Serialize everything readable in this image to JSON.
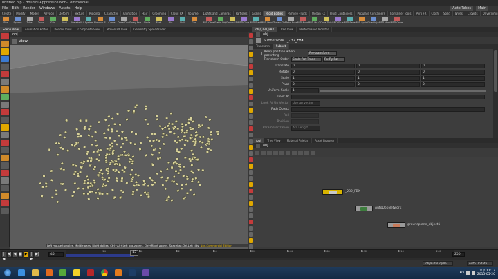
{
  "window": {
    "title": "untitled.hip - Houdini Apprentice Non-Commercial"
  },
  "menu": {
    "items": [
      "File",
      "Edit",
      "Render",
      "Windows",
      "Assets",
      "Help"
    ],
    "right_dropdown": "Auto Takes",
    "right_button": "Main"
  },
  "shelf_tabs": {
    "left": [
      "Create",
      "Modify",
      "Model",
      "Polygon",
      "Deform",
      "Texture",
      "Rigging",
      "Character",
      "Animation",
      "Hair",
      "Grooming",
      "Cloud FX",
      "Volume"
    ],
    "right": [
      "Lights and Cameras",
      "Particles",
      "Grains",
      "Rigid Bodies",
      "Particle Fluids",
      "Ocean FX",
      "Fluid Containers",
      "Populate Containers",
      "Container Tools",
      "Pyro FX",
      "Cloth",
      "Solid",
      "Wires",
      "Crowds",
      "Drive Simulation"
    ],
    "active_right": "Rigid Bodies"
  },
  "shelf_tools": {
    "left": [
      "Box",
      "Sphere",
      "Tube",
      "Torus",
      "Grid",
      "Null",
      "Metaball",
      "L-System",
      "Platonic Sol.",
      "Curve",
      "Draw Curve",
      "Spray Paint",
      "Circle",
      "Font",
      "File",
      "Null",
      "Geo"
    ],
    "right": [
      "RBD Object",
      "Static Object",
      "Ground Plane",
      "RBD Glue Object",
      "RBD Fractured Object",
      "RBD Point Object",
      "Terrain Object",
      "Make Breakable",
      "RBD Auto Freeze",
      "RBD Pin Constraint",
      "Cone Twist",
      "RBD Glue",
      "RBD Sever",
      "RBD Spring Constraint",
      "Glue Adjacent",
      "RBD Hard Constraint",
      "RBD Cone Twist"
    ]
  },
  "left_tabs": [
    "Scene View",
    "Animation Editor",
    "Render View",
    "Composite View",
    "Motion FX View",
    "Geometry Spreadsheet"
  ],
  "viewport": {
    "path": "obj",
    "view_label": "View"
  },
  "viewport_status": {
    "text": "Left mouse tumbles. Middle pans. Right dollies. Ctrl+Alt+Left box-zooms. Ctrl+Right zooms. Spacebar-Ctrl-Left tilts.",
    "badge": "Non-Commercial Edition"
  },
  "param_tabs": [
    "/obj/_232_FBX",
    "Tree View",
    "Performance Monitor"
  ],
  "params": {
    "path": "obj",
    "node_type": "Subnetwork",
    "node_name": "_232_FBX",
    "tabs": [
      "Transform",
      "Subnet"
    ],
    "keep_position_label": "Keep position when parenting",
    "keep_position_value": "Pre-transform",
    "transform_order_label": "Transform Order",
    "transform_order": "Scale Rot Trans",
    "rotate_order": "Rx Ry Rz",
    "rows": [
      {
        "label": "Translate",
        "v": [
          "0",
          "0",
          "0"
        ]
      },
      {
        "label": "Rotate",
        "v": [
          "0",
          "0",
          "0"
        ]
      },
      {
        "label": "Scale",
        "v": [
          "1",
          "1",
          "1"
        ]
      },
      {
        "label": "Pivot",
        "v": [
          "0",
          "0",
          "0"
        ]
      }
    ],
    "uniform_scale_label": "Uniform Scale",
    "uniform_scale": "1",
    "look_at_label": "Look At",
    "look_at_up_label": "Look At Up Vector",
    "look_at_up_value": "Use up vector",
    "path_object_label": "Path Object",
    "roll_label": "Roll",
    "position_label": "Position",
    "param_label": "Parameterization",
    "param_value": "Arc Length"
  },
  "net_tabs": [
    "/obj",
    "Tree View",
    "Material Palette",
    "Asset Browser"
  ],
  "network": {
    "path": "obj",
    "nodes": [
      {
        "label": "_232_FBX",
        "color": "#d8b400"
      },
      {
        "label": "AutoDopNetwork",
        "color": "#9a9a9a"
      },
      {
        "label": "groundplane_object1",
        "color": "#9a9a9a"
      }
    ]
  },
  "timeline": {
    "start": "1",
    "current": "45",
    "frame_field": "45",
    "end": "250",
    "ticks": [
      "24",
      "48",
      "72",
      "96",
      "120",
      "144",
      "168",
      "192",
      "216",
      "240"
    ],
    "playback": [
      "|◀",
      "◀|",
      "◀",
      "■",
      "▶",
      "|▶",
      "▶|"
    ]
  },
  "bottom": {
    "net_path": "/obj/AutoDopNe",
    "auto_update": "Auto Update"
  },
  "taskbar": {
    "lang": "KO",
    "time": "오후 11:17",
    "date": "2015-05-20"
  },
  "colors": {
    "points": "#d8d29a",
    "node_selected": "#d8b400",
    "accent": "#e0a800"
  }
}
